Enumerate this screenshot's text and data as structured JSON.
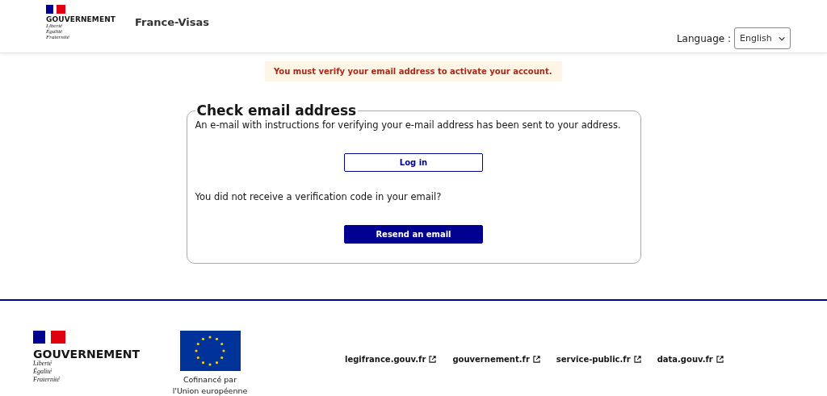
{
  "header": {
    "logo": {
      "name": "GOUVERNEMENT",
      "motto": [
        "Liberté",
        "Égalité",
        "Fraternité"
      ]
    },
    "site_name": "France-Visas",
    "language": {
      "label": "Language :",
      "value": "English"
    }
  },
  "alert": "You must verify your email address to activate your account.",
  "panel": {
    "title": "Check email address",
    "message": "An e-mail with instructions for verifying your e-mail address has been sent to your address.",
    "buttons": [
      {
        "label": "Log in",
        "kind": "secondary"
      }
    ],
    "question": "You did not receive a verification code in your email?",
    "buttons_2": [
      {
        "label": "Resend an email",
        "kind": "primary"
      }
    ]
  },
  "footer": {
    "logo": {
      "name": "GOUVERNEMENT",
      "motto": [
        "Liberté",
        "Égalité",
        "Fraternité"
      ]
    },
    "eu_caption": [
      "Cofinancé par",
      "l'Union européenne"
    ],
    "links": [
      "legifrance.gouv.fr",
      "gouvernement.fr",
      "service-public.fr",
      "data.gouv.fr"
    ]
  }
}
